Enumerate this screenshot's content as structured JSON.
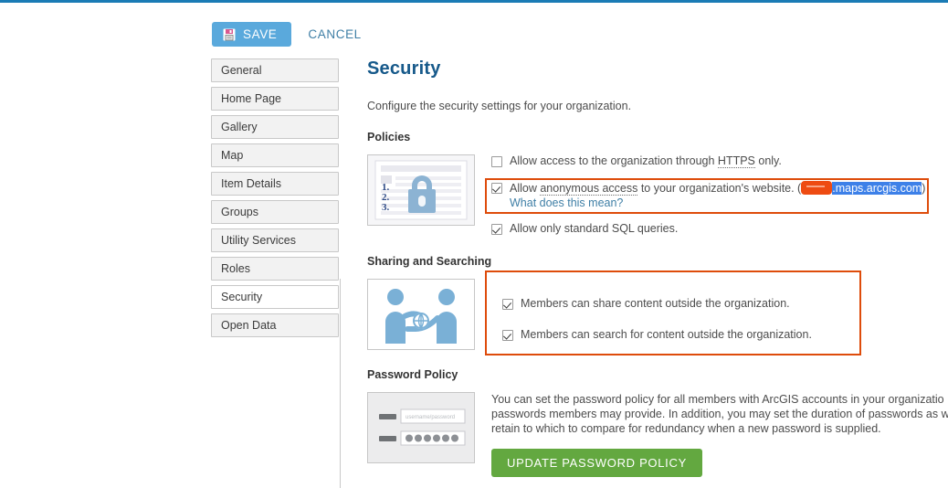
{
  "theme": {
    "accent_blue": "#1a7bb5",
    "save_blue": "#5aa9dc",
    "link_blue": "#3f7fa6",
    "title_blue": "#16598a",
    "highlight_orange": "#de4c0b",
    "redaction_orange": "#ee4b12",
    "selection_blue": "#3d80e8",
    "button_green": "#63a840"
  },
  "toolbar": {
    "save_label": "SAVE",
    "cancel_label": "CANCEL",
    "save_icon": "floppy-disk-icon"
  },
  "sidebar": {
    "items": [
      {
        "label": "General",
        "selected": false
      },
      {
        "label": "Home Page",
        "selected": false
      },
      {
        "label": "Gallery",
        "selected": false
      },
      {
        "label": "Map",
        "selected": false
      },
      {
        "label": "Item Details",
        "selected": false
      },
      {
        "label": "Groups",
        "selected": false
      },
      {
        "label": "Utility Services",
        "selected": false
      },
      {
        "label": "Roles",
        "selected": false
      },
      {
        "label": "Security",
        "selected": true
      },
      {
        "label": "Open Data",
        "selected": false
      }
    ]
  },
  "main": {
    "title": "Security",
    "description": "Configure the security settings for your organization.",
    "policies": {
      "heading": "Policies",
      "thumbnail_icon": "padlock-document-icon",
      "items": [
        {
          "checked": false,
          "text_before": "Allow access to the organization through ",
          "dotted_term": "HTTPS",
          "text_after": " only."
        },
        {
          "checked": true,
          "text_before": "Allow ",
          "dotted_term": "anonymous access",
          "text_after": " to your organization's website. (",
          "url_redacted": "redaction-block",
          "url_selected": ".maps.arcgis.com",
          "url_close": ")",
          "sub_link": "What does this mean?"
        },
        {
          "checked": true,
          "text_before": "Allow only standard SQL queries.",
          "dotted_term": "",
          "text_after": ""
        }
      ]
    },
    "sharing": {
      "heading": "Sharing and Searching",
      "thumbnail_icon": "people-sharing-globe-icon",
      "items": [
        {
          "checked": true,
          "label": "Members can share content outside the organization."
        },
        {
          "checked": true,
          "label": "Members can search for content outside the organization."
        }
      ]
    },
    "password_policy": {
      "heading": "Password Policy",
      "thumbnail_icon": "login-form-icon",
      "paragraph_lines": [
        "You can set the password policy for all members with ArcGIS accounts in your organizatio",
        "passwords members may provide. In addition, you may set the duration of passwords as w",
        "retain to which to compare for redundancy when a new password is supplied."
      ],
      "button_label": "UPDATE PASSWORD POLICY"
    }
  }
}
